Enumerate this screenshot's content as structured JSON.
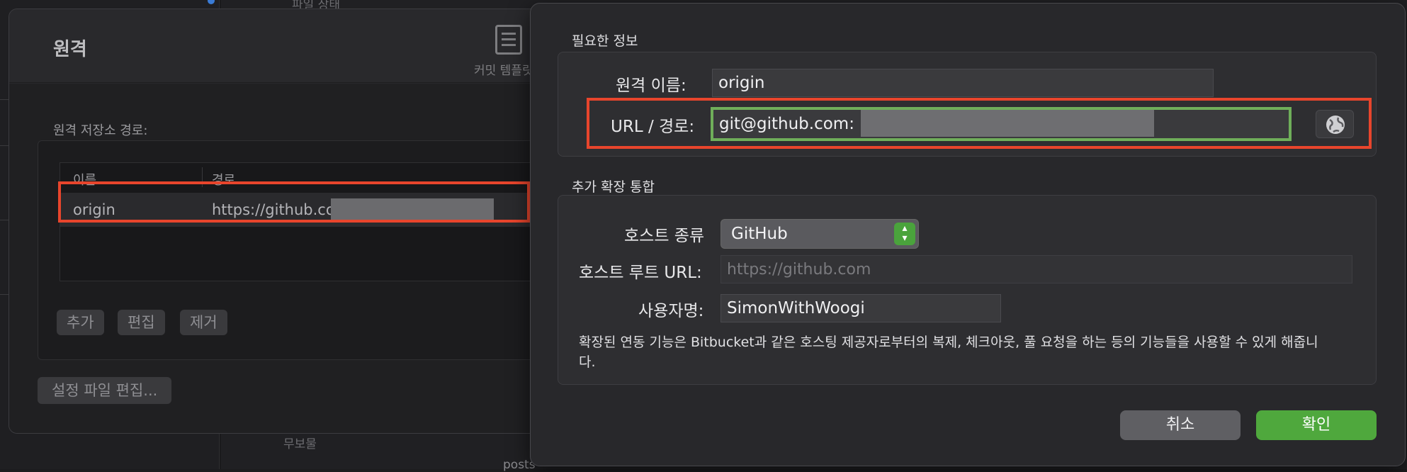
{
  "background": {
    "top_text": "파일 상태",
    "bottom_text": "무보물",
    "bottom_text2": "posts"
  },
  "remote_dialog": {
    "title": "원격",
    "commit_template_label": "커밋 템플릿",
    "path_label": "원격 저장소 경로:",
    "columns": [
      "이름",
      "경로"
    ],
    "rows": [
      {
        "name": "origin",
        "path": "https://github.com"
      }
    ],
    "buttons": {
      "add": "추가",
      "edit": "편집",
      "remove": "제거",
      "edit_config": "설정 파일 편집..."
    }
  },
  "sheet": {
    "required_section_title": "필요한 정보",
    "remote_name_label": "원격 이름:",
    "remote_name_value": "origin",
    "url_label": "URL / 경로:",
    "url_value": "git@github.com:",
    "extension_section_title": "추가 확장 통합",
    "host_type_label": "호스트 종류",
    "host_type_value": "GitHub",
    "host_root_url_label": "호스트 루트 URL:",
    "host_root_url_placeholder": "https://github.com",
    "username_label": "사용자명:",
    "username_value": "SimonWithWoogi",
    "description": "확장된 연동 기능은 Bitbucket과 같은 호스팅 제공자로부터의 복제, 체크아웃, 풀 요청을 하는 등의 기능들을 사용할 수 있게 해줍니다.",
    "cancel_label": "취소",
    "ok_label": "확인"
  },
  "colors": {
    "highlight": "#e8452c",
    "focus_ring": "#6fae5a",
    "accent_green": "#4fa83d"
  },
  "icons": [
    "globe-icon",
    "stepper-icon",
    "commit-template-icon"
  ]
}
